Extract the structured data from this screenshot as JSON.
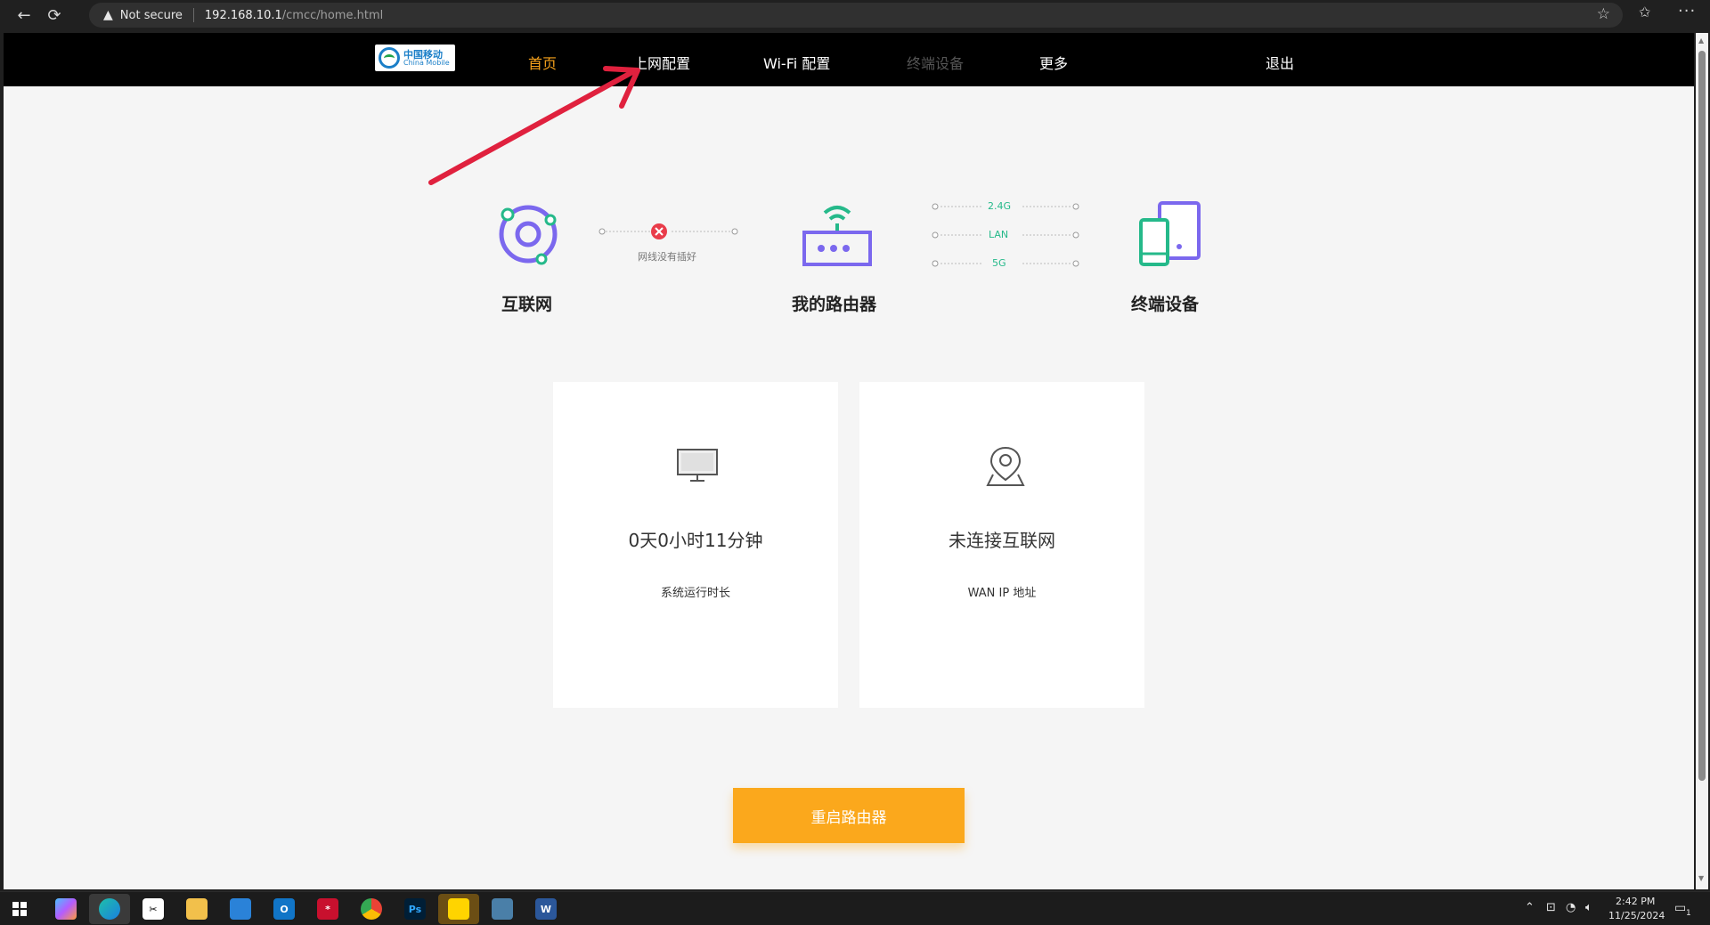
{
  "browser": {
    "security_label": "Not secure",
    "url_host": "192.168.10.1",
    "url_path": "/cmcc/home.html"
  },
  "router_nav": {
    "logo_cn": "中国移动",
    "logo_en": "China Mobile",
    "items": [
      {
        "label": "首页",
        "state": "active"
      },
      {
        "label": "上网配置",
        "state": "normal"
      },
      {
        "label": "Wi-Fi 配置",
        "state": "normal"
      },
      {
        "label": "终端设备",
        "state": "disabled"
      },
      {
        "label": "更多",
        "state": "normal"
      }
    ],
    "logout_label": "退出",
    "active_color": "#f7a21b"
  },
  "status": {
    "internet_label": "互联网",
    "router_label": "我的路由器",
    "devices_label": "终端设备",
    "wan_link_caption": "网线没有插好",
    "bands": [
      "2.4G",
      "LAN",
      "5G"
    ],
    "error_color": "#e93c4a",
    "band_color": "#25b98a"
  },
  "cards": {
    "uptime": {
      "value": "0天0小时11分钟",
      "caption": "系统运行时长",
      "icon": "monitor-icon"
    },
    "wan_ip": {
      "value": "未连接互联网",
      "caption": "WAN IP 地址",
      "icon": "location-pin-icon"
    }
  },
  "actions": {
    "reboot_label": "重启路由器",
    "reboot_color": "#fba81c"
  },
  "taskbar": {
    "time": "2:42 PM",
    "date": "11/25/2024",
    "notification_count": "1"
  }
}
